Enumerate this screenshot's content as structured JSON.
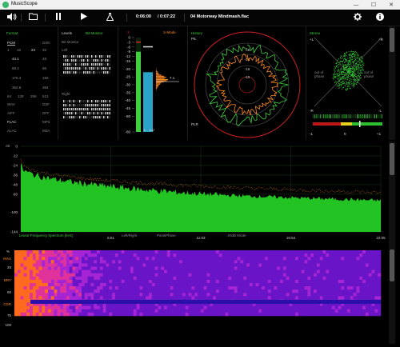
{
  "window": {
    "title": "MusicScope",
    "minimize": "—",
    "maximize": "☐",
    "close": "✕"
  },
  "toolbar": {
    "elapsed": "0:06:00",
    "total": "/ 0:07:22",
    "track": "04 Motorway Mindmash.flac"
  },
  "format_panel": {
    "title": "Format",
    "pcm": "PCM",
    "dsd": "DSD",
    "bits": [
      "1",
      "16",
      "24",
      "32"
    ],
    "rates": [
      [
        "44.1",
        "48"
      ],
      [
        "88.2",
        "96"
      ],
      [
        "176.4",
        "192"
      ],
      [
        "352.8",
        "384"
      ]
    ],
    "dsd_rates": [
      "64",
      "128",
      "256",
      "512"
    ],
    "formats": [
      [
        "WAV",
        "DSF"
      ],
      [
        "AIFF",
        "DFF"
      ],
      [
        "FLAC",
        "MP3"
      ],
      [
        "ALAC",
        "M4A"
      ]
    ]
  },
  "levels_panel": {
    "title": "Levels",
    "bit_monitor": "Bit Monitor",
    "bit_monitor_sub": "Bit Monitor",
    "left": "Left",
    "right": "Right",
    "scale": [
      "0",
      "-3",
      "-6",
      "-9",
      "-12",
      "-15",
      "-20",
      "-25",
      "-30",
      "-35",
      "-40",
      "-45",
      "-50",
      "-60"
    ],
    "channel_l": "L",
    "channel_lu": "LU",
    "peak_l": -3,
    "peak_r": -6,
    "level_l": -9,
    "level_r": -22,
    "readout": "7.1",
    "s_mode": "S-Mode",
    "s_value": "3"
  },
  "history_panel": {
    "title": "History",
    "pil": "PIL",
    "plr": "PLR",
    "rings": [
      "-48",
      "-24",
      "-16",
      "-10"
    ]
  },
  "stereo_panel": {
    "title": "Stereo",
    "tl": "+L",
    "tr": "+R",
    "bl": "-R",
    "br": "-L",
    "left_text": "out of phase",
    "right_text": "out of phase",
    "corr_min": "-1",
    "corr_mid": "0",
    "corr_max": "+1"
  },
  "spectrum": {
    "db_label": "dB",
    "y_ticks": [
      "0",
      "-12",
      "-24",
      "-36",
      "-48",
      "-60",
      "-100",
      "-144"
    ],
    "x_ticks": [
      "5:51",
      "11:03",
      "16:54",
      "22:05"
    ],
    "mode_label": "Linear Frequency Spectrum (kHz)",
    "tab_left_right": "Left/Right",
    "tab_pan_phase": "Pan&Phase",
    "tab_20db": "-20dB Mode"
  },
  "loudness_history": {
    "pct": "%",
    "labels": [
      "MAX",
      "25",
      "BRY",
      "50",
      "CDR",
      "75",
      "100"
    ]
  },
  "colors": {
    "green": "#3fcf3f",
    "orange": "#ff8a1f",
    "red": "#e02020",
    "blue": "#29a3c9"
  }
}
